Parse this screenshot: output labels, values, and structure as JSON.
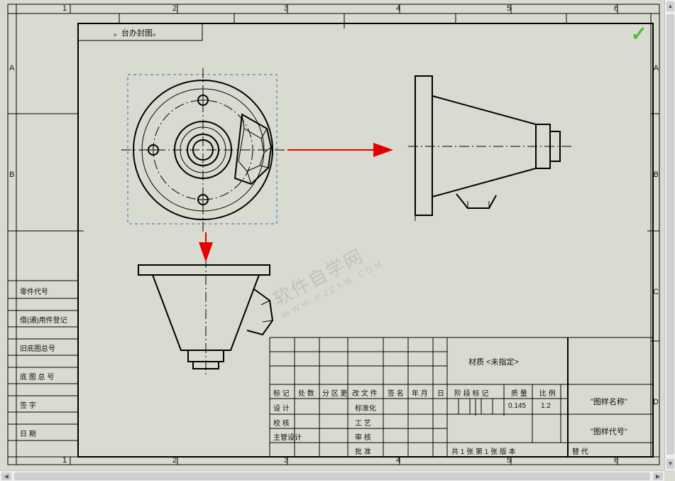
{
  "ruler_cols": [
    "1",
    "2",
    "3",
    "4",
    "5",
    "6"
  ],
  "ruler_rows": [
    "A",
    "B",
    "C",
    "D"
  ],
  "template_label": "。台办封图。",
  "ok_mark": "✓",
  "watermark_main": "软件自学网",
  "watermark_sub": "WWW.RJZXW.COM",
  "left_rows": {
    "r1": "零件代号",
    "r2": "借(通)用件登记",
    "r3": "旧底图总号",
    "r4": "底 图 总 号",
    "r5": "签    字",
    "r6": "日    期"
  },
  "titleblock": {
    "material": "材质 <未指定>",
    "name": "\"图样名称\"",
    "code": "\"图样代号\"",
    "hdr_mark": "标 记",
    "hdr_qty": "处 数",
    "hdr_zone": "分 区 更",
    "hdr_doc": "改 文 件",
    "hdr_sign": "签 名",
    "hdr_ym": "年 月",
    "hdr_day": "日",
    "hdr_stage": "阶 段 标 记",
    "hdr_mass": "质 量",
    "hdr_scale": "比 例",
    "val_mass": "0.145",
    "val_scale": "1:2",
    "row_design": "设 计",
    "row_check": "校 核",
    "row_chief": "主管设计",
    "row_std": "标准化",
    "row_proc": "工 艺",
    "row_review": "审 核",
    "row_approve": "批 准",
    "footer_sheets": "共 1 张 第 1 张 版 本",
    "footer_sub": "替 代"
  }
}
